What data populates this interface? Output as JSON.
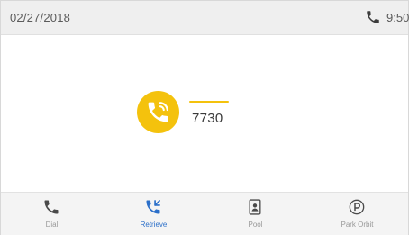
{
  "status_bar": {
    "date": "02/27/2018",
    "time": "9:50",
    "phone_icon": "phone-icon"
  },
  "call": {
    "icon": "phone-call-icon",
    "number": "7730",
    "accent_color": "#f4c20d"
  },
  "softkeys": [
    {
      "label": "Dial",
      "icon": "phone-icon"
    },
    {
      "label": "Retrieve",
      "icon": "call-retrieve-icon",
      "active": true
    },
    {
      "label": "Pool",
      "icon": "contact-card-icon"
    },
    {
      "label": "Park Orbit",
      "icon": "park-icon"
    }
  ],
  "colors": {
    "active_softkey": "#2b6fc9",
    "status_bar_bg": "#efefef"
  }
}
